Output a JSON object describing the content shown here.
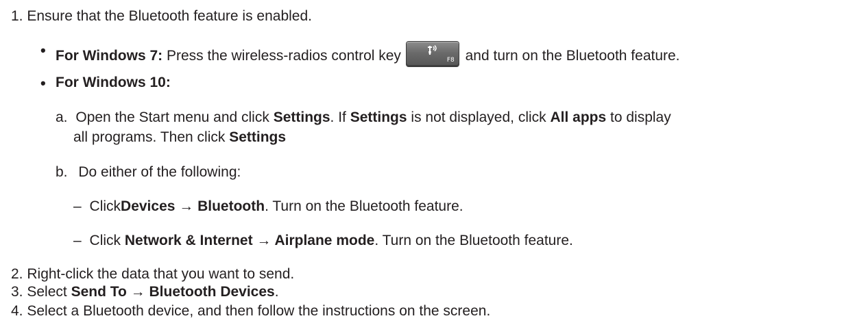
{
  "steps": [
    {
      "num": "1.",
      "text": "Ensure that the Bluetooth feature is enabled."
    },
    {
      "num": "2.",
      "text": "Right-click the data that you want to send."
    },
    {
      "num": "3.",
      "text_pre": "Select ",
      "text_bold": "Send To → Bluetooth Devices",
      "text_post": "."
    },
    {
      "num": "4.",
      "text": "Select a Bluetooth device, and then follow the instructions on the screen."
    }
  ],
  "win7": {
    "bullet": "•",
    "label": "For Windows 7:",
    "text_pre": " Press the wireless-radios control key ",
    "text_post": " and turn on the Bluetooth feature.",
    "key": {
      "glyph": "Ⓦ",
      "fkey": "F8",
      "icon": "wireless-radio-icon"
    }
  },
  "win10": {
    "bullet": "•",
    "label": "For Windows 10:",
    "sub_a": {
      "letter": "a.",
      "t1": "Open the Start menu and click ",
      "b1": "Settings",
      "t2": ". If ",
      "b2": "Settings",
      "t3": " is not displayed, click ",
      "b3": "All apps",
      "t4": " to display",
      "l2_t1": "all programs. Then click ",
      "l2_b1": "Settings"
    },
    "sub_b": {
      "letter": "b.",
      "text": "Do either of the following:",
      "dash1": {
        "dash": "–",
        "t1": "Click",
        "b1": "Devices → Bluetooth",
        "t2": ". Turn on the Bluetooth feature."
      },
      "dash2": {
        "dash": "–",
        "t1": "Click ",
        "b1": "Network & Internet → Airplane mode",
        "t2": ". Turn on the Bluetooth feature."
      }
    }
  }
}
